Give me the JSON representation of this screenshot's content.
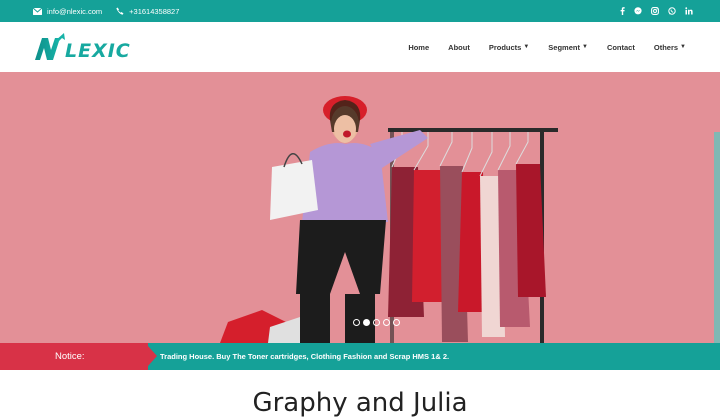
{
  "topbar": {
    "email": "info@nlexic.com",
    "phone": "+31614358827",
    "social_icons": [
      "facebook-icon",
      "messenger-icon",
      "instagram-icon",
      "whatsapp-icon",
      "linkedin-icon"
    ]
  },
  "brand": {
    "logo_text": "LEXIC",
    "logo_letter": "N"
  },
  "nav": {
    "home": "Home",
    "about": "About",
    "products": "Products",
    "segment": "Segment",
    "contact": "Contact",
    "others": "Others"
  },
  "hero": {
    "slide_count": 5,
    "active_slide": 2
  },
  "notice": {
    "label": "Notice:",
    "text": "Trading House. Buy The Toner cartridges, Clothing Fashion and Scrap HMS 1& 2."
  },
  "section": {
    "title": "Graphy and Julia"
  },
  "colors": {
    "teal": "#15a198",
    "red": "#d83247",
    "hero_bg": "#e08b92"
  }
}
